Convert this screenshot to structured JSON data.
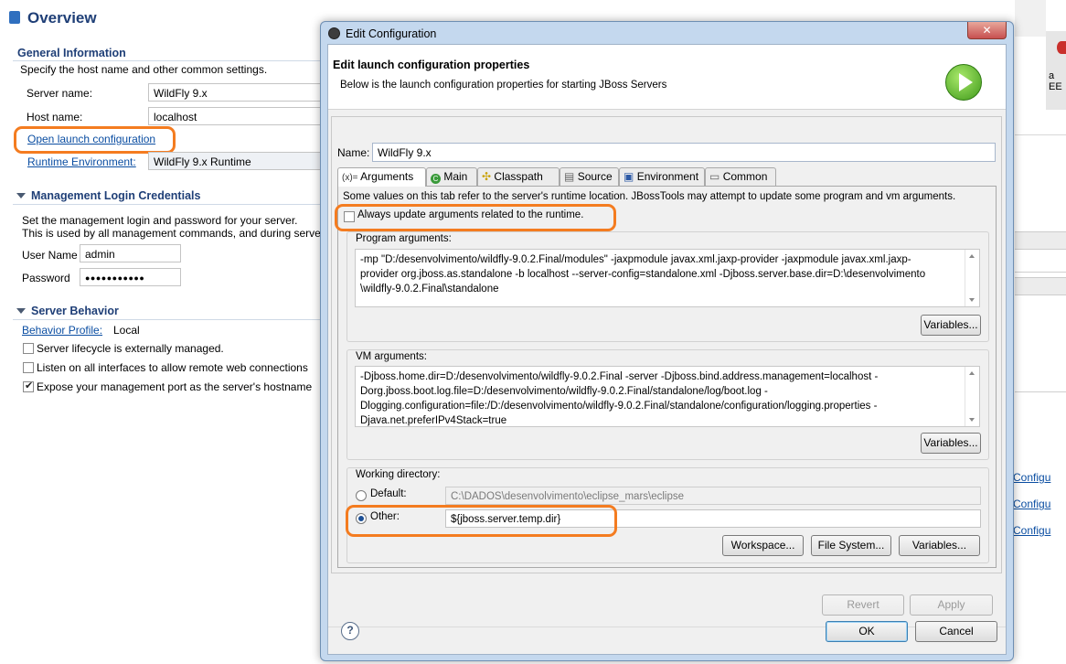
{
  "editor": {
    "title": "Overview",
    "general": {
      "heading": "General Information",
      "description": "Specify the host name and other common settings.",
      "server_name_label": "Server name:",
      "server_name_value": "WildFly  9.x",
      "host_name_label": "Host name:",
      "host_name_value": "localhost",
      "open_launch_config": "Open launch configuration",
      "runtime_env_label": "Runtime Environment:",
      "runtime_env_value": "WildFly 9.x Runtime"
    },
    "management": {
      "heading": "Management Login Credentials",
      "desc1": "Set the management login and password for your server.",
      "desc2": "This is used by all management commands, and during server",
      "user_label": "User Name",
      "user_value": "admin",
      "password_label": "Password",
      "password_value": "●●●●●●●●●●●"
    },
    "behavior": {
      "heading": "Server Behavior",
      "profile_label": "Behavior Profile:",
      "profile_value": "Local",
      "options": [
        {
          "label": "Server lifecycle is externally managed.",
          "checked": false
        },
        {
          "label": "Listen on all interfaces to allow remote web connections",
          "checked": false
        },
        {
          "label": "Expose your management port as the server's hostname",
          "checked": true
        }
      ]
    },
    "right_edge": {
      "partial_text": "a EE",
      "config_links": [
        "Configu",
        "Configu",
        "Configu"
      ]
    }
  },
  "dialog": {
    "title": "Edit Configuration",
    "header_title": "Edit launch configuration properties",
    "header_subtitle": "Below is the launch configuration properties for starting JBoss Servers",
    "name_label": "Name:",
    "name_value": "WildFly  9.x",
    "tabs": [
      {
        "label": "Arguments",
        "icon": "arguments-icon",
        "active": true
      },
      {
        "label": "Main",
        "icon": "main-icon",
        "active": false
      },
      {
        "label": "Classpath",
        "icon": "classpath-icon",
        "active": false
      },
      {
        "label": "Source",
        "icon": "source-icon",
        "active": false
      },
      {
        "label": "Environment",
        "icon": "environment-icon",
        "active": false
      },
      {
        "label": "Common",
        "icon": "common-icon",
        "active": false
      }
    ],
    "notice": "Some values on this tab refer to the server's runtime location. JBossTools may attempt to update some program and vm arguments.",
    "always_update_label": "Always update arguments related to the runtime.",
    "always_update_checked": false,
    "program_args_label": "Program arguments:",
    "program_args_lines": [
      "-mp \"D:/desenvolvimento/wildfly-9.0.2.Final/modules\" -jaxpmodule javax.xml.jaxp-provider -jaxpmodule javax.xml.jaxp-",
      "provider org.jboss.as.standalone -b localhost --server-config=standalone.xml -Djboss.server.base.dir=D:\\desenvolvimento",
      "\\wildfly-9.0.2.Final\\standalone"
    ],
    "vm_args_label": "VM arguments:",
    "vm_args_lines": [
      "-Djboss.home.dir=D:/desenvolvimento/wildfly-9.0.2.Final -server -Djboss.bind.address.management=localhost -",
      "Dorg.jboss.boot.log.file=D:/desenvolvimento/wildfly-9.0.2.Final/standalone/log/boot.log -",
      "Dlogging.configuration=file:/D:/desenvolvimento/wildfly-9.0.2.Final/standalone/configuration/logging.properties -",
      "Djava.net.preferIPv4Stack=true"
    ],
    "variables_label": "Variables...",
    "working_dir_label": "Working directory:",
    "default_label": "Default:",
    "default_value": "C:\\DADOS\\desenvolvimento\\eclipse_mars\\eclipse",
    "other_label": "Other:",
    "other_value": "${jboss.server.temp.dir}",
    "workspace_label": "Workspace...",
    "filesystem_label": "File System...",
    "revert_label": "Revert",
    "apply_label": "Apply",
    "ok_label": "OK",
    "cancel_label": "Cancel",
    "help_glyph": "?",
    "close_glyph": "✕"
  },
  "colors": {
    "highlight": "#f47c20",
    "heading": "#1f3f77",
    "link": "#0b4ea2"
  }
}
